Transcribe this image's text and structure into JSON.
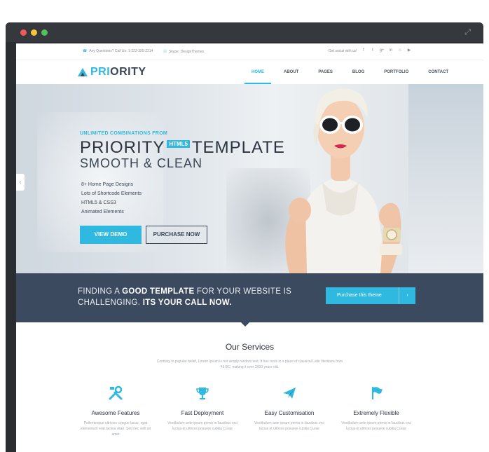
{
  "window": {
    "expand_icon": "expand-icon"
  },
  "topbar": {
    "contact": "Any Questions? Call Us: 1-223-355-2214",
    "skype": "Skype: DesignThemes",
    "social_label": "Get social with us!",
    "socials": [
      "f",
      "t",
      "g+",
      "in",
      "⌂",
      "▶"
    ]
  },
  "nav": {
    "logo_accent": "PRI",
    "logo_rest": "ORITY",
    "items": [
      "HOME",
      "ABOUT",
      "PAGES",
      "BLOG",
      "PORTFOLIO",
      "CONTACT"
    ]
  },
  "hero": {
    "eyebrow": "UNLIMITED COMBINATIONS FROM",
    "title_part1": "PRIORITY",
    "title_badge": "HTML5",
    "title_part2": "TEMPLATE",
    "subtitle": "SMOOTH & CLEAN",
    "features": [
      "8+ Home Page Designs",
      "Lots of Shortcode Elements",
      "HTML5  & CSS3",
      "Animated Elements"
    ],
    "demo_button": "VIEW DEMO",
    "purchase_button": "PURCHASE NOW",
    "prev_arrow": "‹"
  },
  "cta": {
    "line1_a": "FINDING A ",
    "line1_b": "GOOD TEMPLATE",
    "line1_c": " FOR YOUR WEBSITE IS",
    "line2_a": "CHALLENGING. ",
    "line2_b": "ITS YOUR CALL NOW.",
    "button": "Purchase this theme",
    "button_arrow": "›"
  },
  "services": {
    "title": "Our Services",
    "intro": "Contrary to popular belief, Lorem Ipsum is not simply random text. It has roots in a piece of classical Latin literature from 45 BC, making it over 2000 years old.",
    "items": [
      {
        "name": "Awesome Features",
        "desc": "Pellentesque ultricies congue lacus, eget elementum erat lacinia vitae. Sed nec velit sit amet",
        "icon": "tools-icon"
      },
      {
        "name": "Fast Deployment",
        "desc": "Vestibulum ante ipsum primis in faucibus orci luctus et ultrices posuere cubilia Curae",
        "icon": "trophy-icon"
      },
      {
        "name": "Easy Customisation",
        "desc": "Vestibulum ante ipsum primis in faucibus orci luctus et ultrices posuere cubilia Curae",
        "icon": "paper-plane-icon"
      },
      {
        "name": "Extremely Flexible",
        "desc": "Vestibulum ante ipsum primis in faucibus orci luctus et ultrices posuere cubilia Curae",
        "icon": "flag-icon"
      }
    ]
  },
  "colors": {
    "accent": "#2fb8e0",
    "dark": "#3b4a5e",
    "text": "#2c3440"
  }
}
